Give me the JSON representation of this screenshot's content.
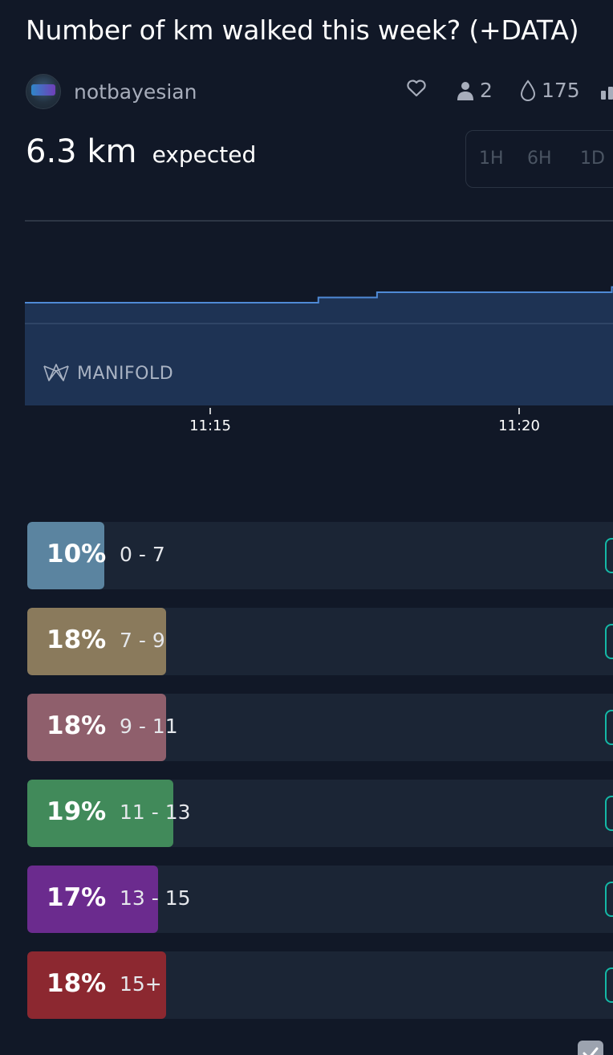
{
  "title": "Number of km walked this week? (+DATA)",
  "creator": {
    "name": "notbayesian"
  },
  "stats": {
    "traders": "2",
    "volume": "175"
  },
  "probability": {
    "value": "6.3 km",
    "label": "expected"
  },
  "time_range_tabs": [
    "1H",
    "6H",
    "1D"
  ],
  "chart_data": {
    "type": "area",
    "x_ticks": [
      "11:15",
      "11:20"
    ],
    "x": [
      "11:12",
      "11:17",
      "11:18",
      "11:21",
      "11:22"
    ],
    "y": [
      6.0,
      6.1,
      6.2,
      6.2,
      6.3
    ],
    "series": [
      {
        "values": [
          6.0,
          6.1,
          6.2,
          6.2,
          6.3
        ]
      }
    ],
    "watermark": "MANIFOLD"
  },
  "answers": [
    {
      "percent": "10%",
      "label": "0 - 7",
      "value": 10,
      "color": "#5b84a0"
    },
    {
      "percent": "18%",
      "label": "7 - 9",
      "value": 18,
      "color": "#8a7a5c"
    },
    {
      "percent": "18%",
      "label": "9 - 11",
      "value": 18,
      "color": "#8f5f6c"
    },
    {
      "percent": "19%",
      "label": "11 - 13",
      "value": 19,
      "color": "#418a5a"
    },
    {
      "percent": "17%",
      "label": "13 - 15",
      "value": 17,
      "color": "#6b2b8e"
    },
    {
      "percent": "18%",
      "label": "15+",
      "value": 18,
      "color": "#8c2830"
    }
  ]
}
